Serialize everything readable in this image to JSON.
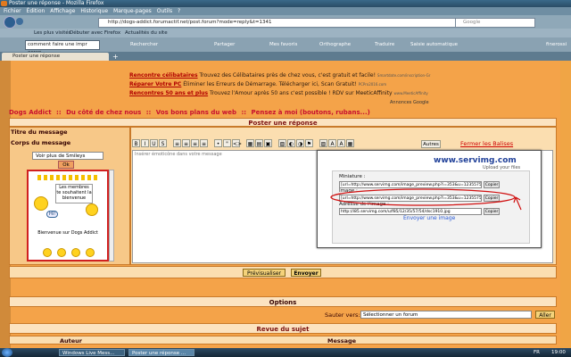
{
  "browser": {
    "window_title": "Poster une réponse - Mozilla Firefox",
    "menu": [
      "Fichier",
      "Édition",
      "Affichage",
      "Historique",
      "Marque-pages",
      "Outils",
      "?"
    ],
    "url": "http://dogs-addict.forumactif.net/post.forum?mode=reply&t=1341",
    "search_placeholder": "Google",
    "bookmarks": [
      "Les plus visités",
      "Débuter avec Firefox",
      "Actualités du site"
    ],
    "google_query": "comment faire une impr ecran",
    "google_buttons": [
      "Rechercher",
      "Partager",
      "Mes favoris",
      "Orthographe",
      "Traduire",
      "Saisie automatique"
    ],
    "user": "finerossi",
    "tab_label": "Poster une réponse"
  },
  "ads": [
    {
      "headline": "Rencontre célibataires",
      "text": "Trouvez des Célibataires près de chez vous, c'est gratuit et facile!",
      "source": "Smartdate.com/inscription-Gr"
    },
    {
      "headline": "Réparer Votre PC",
      "text": "Éliminer les Erreurs de Démarrage. Télécharger ici, Scan Gratuit!",
      "source": "PCPro2016.com"
    },
    {
      "headline": "Rencontres 50 ans et plus",
      "text": "Trouvez l'Amour après 50 ans c'est possible ! RDV sur MeeticAffinity",
      "source": "www.MeeticAffinity"
    }
  ],
  "ads_by": "Annonces Google",
  "breadcrumb": [
    "Dogs Addict",
    "::",
    "Du côté de chez nous",
    "::",
    "Vos bons plans du web",
    "::",
    "Pensez à moi (boutons, rubans...)"
  ],
  "form": {
    "header": "Poster une réponse",
    "title_label": "Titre du message",
    "body_label": "Corps du message",
    "smileys_select": "Voir plus de Smileys",
    "ok": "Ok",
    "smiley_sign": "Les membres te souhaitent la bienvenue",
    "smiley_hi": "HI!",
    "smiley_caption": "Bienvenue sur Dogs Addict",
    "toolbar_buttons": [
      "B",
      "I",
      "U",
      "S",
      "≡",
      "≡",
      "≡",
      "≡",
      "•",
      "\"",
      "<>",
      "▦",
      "▤",
      "▣",
      "▧",
      "◐",
      "◑",
      "⚑",
      "▨",
      "A",
      "A",
      "▦"
    ],
    "autres": "Autres",
    "fermer": "Fermer les Balises",
    "editor_placeholder": "Insérer émoticône dans votre message",
    "screenshot": {
      "logo": "www.servimg.com",
      "subtitle": "Upload your files",
      "miniature_label": "Miniature :",
      "miniature_value": "[url=http://www.servimg.com/image_preview.php?i=353&u=12355754][img]",
      "image_label": "Image :",
      "image_value": "[url=http://www.servimg.com/image_preview.php?i=353&u=12355754][img]",
      "adresse_label": "Adresse de l'image :",
      "adresse_value": "http://i85.servimg.com/u/f85/12/35/57/54/dsc1910.jpg",
      "copier": "Copier",
      "envoyer": "Envoyer une image"
    },
    "preview_button": "Prévisualiser",
    "send_button": "Envoyer"
  },
  "options_header": "Options",
  "jump": {
    "label": "Sauter vers:",
    "select": "Sélectionner un forum",
    "go": "Aller"
  },
  "review": {
    "header": "Revue du sujet",
    "col_author": "Auteur",
    "col_message": "Message"
  },
  "taskbar": {
    "tasks": [
      "Windows Live Mess...",
      "Poster une réponse ..."
    ],
    "lang": "FR",
    "clock": "19:00"
  },
  "colors": {
    "accent_red": "#c8102e",
    "page_orange": "#f4a349",
    "panel_cream": "#fbdeb0"
  }
}
